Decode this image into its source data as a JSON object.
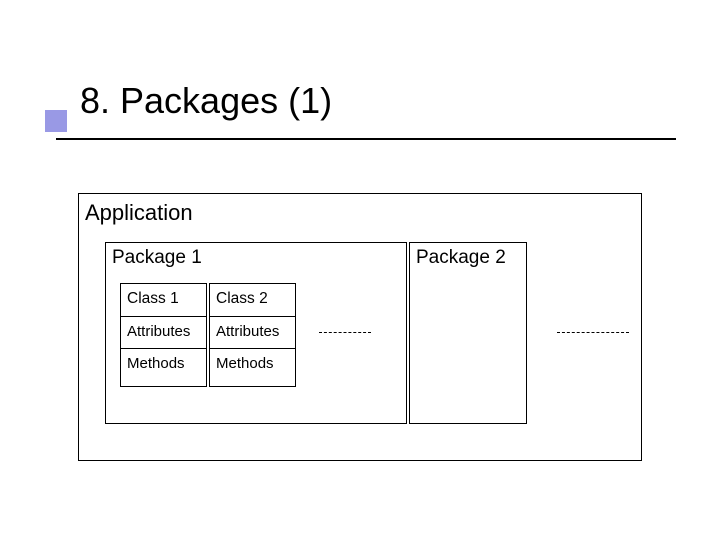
{
  "slide": {
    "title": "8. Packages (1)"
  },
  "diagram": {
    "application": {
      "label": "Application"
    },
    "packages": [
      {
        "label": "Package 1",
        "classes": [
          {
            "name": "Class 1",
            "attributes": "Attributes",
            "methods": "Methods"
          },
          {
            "name": "Class 2",
            "attributes": "Attributes",
            "methods": "Methods"
          }
        ]
      },
      {
        "label": "Package 2",
        "classes": []
      }
    ]
  }
}
